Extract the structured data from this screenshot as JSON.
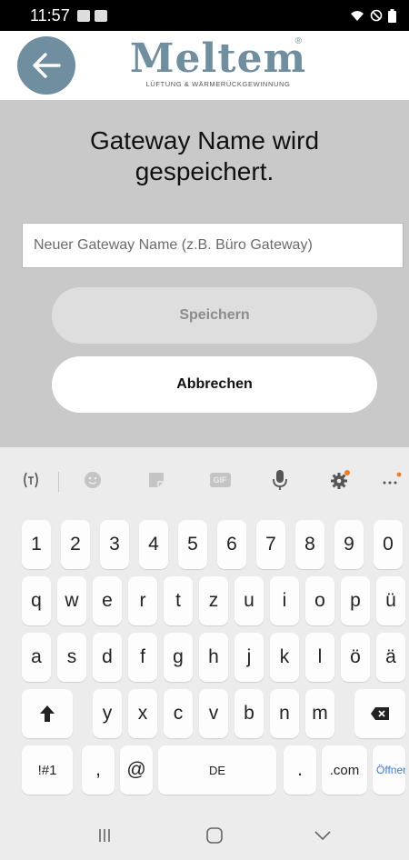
{
  "status_bar": {
    "time": "11:57"
  },
  "header": {
    "logo_text": "Meltem",
    "logo_registered": "®",
    "logo_tagline": "LÜFTUNG & WÄRMERÜCKGEWINNUNG",
    "back_icon": "arrow-left-icon"
  },
  "dialog": {
    "title": "Gateway Name wird gespeichert.",
    "input": {
      "value": "",
      "placeholder": "Neuer Gateway Name (z.B. Büro Gateway)"
    },
    "save_label": "Speichern",
    "cancel_label": "Abbrechen"
  },
  "keyboard": {
    "toolbar_icons": [
      "text-recognition-icon",
      "emoji-icon",
      "sticker-icon",
      "gif-icon",
      "microphone-icon",
      "settings-icon",
      "more-icon"
    ],
    "toolbar_gif_label": "GIF",
    "number_row": [
      "1",
      "2",
      "3",
      "4",
      "5",
      "6",
      "7",
      "8",
      "9",
      "0"
    ],
    "row1": [
      "q",
      "w",
      "e",
      "r",
      "t",
      "z",
      "u",
      "i",
      "o",
      "p",
      "ü"
    ],
    "row2": [
      "a",
      "s",
      "d",
      "f",
      "g",
      "h",
      "j",
      "k",
      "l",
      "ö",
      "ä"
    ],
    "row3": [
      "y",
      "x",
      "c",
      "v",
      "b",
      "n",
      "m"
    ],
    "bottom": {
      "symbols": "!#1",
      "comma": ",",
      "at": "@",
      "space": "DE",
      "period": ".",
      "dotcom": ".com",
      "action": "Öffnen"
    }
  },
  "colors": {
    "accent": "#6f8fa1",
    "dialog_bg": "#c9c9c9",
    "keyboard_bg": "#ececec",
    "open_key": "#3b7de0"
  }
}
